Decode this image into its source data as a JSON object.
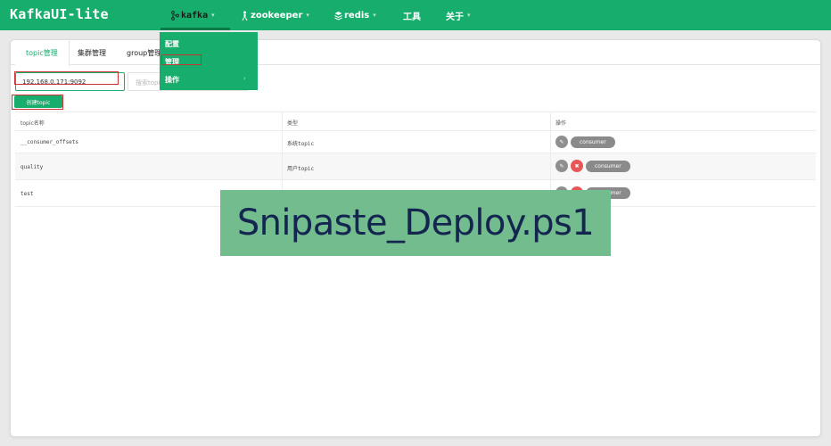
{
  "app": {
    "brand": "KafkaUI-lite"
  },
  "nav": {
    "kafka": {
      "icon": "kafka-icon",
      "label": "kafka"
    },
    "zookeeper": {
      "icon": "zookeeper-icon",
      "label": "zookeeper"
    },
    "redis": {
      "icon": "redis-icon",
      "label": "redis"
    },
    "tools": {
      "label": "工具"
    },
    "about": {
      "label": "关于"
    }
  },
  "dropdown": {
    "config": "配置",
    "manage": "管理",
    "ops": "操作"
  },
  "tabs": [
    {
      "label": "topic管理",
      "active": true
    },
    {
      "label": "集群管理",
      "active": false
    },
    {
      "label": "group管理",
      "active": false
    }
  ],
  "cluster_select": {
    "value": "192.168.0.171:9092"
  },
  "search": {
    "placeholder": "搜索topic"
  },
  "create_button": "创建topic",
  "table": {
    "headers": [
      "topic名称",
      "类型",
      "操作"
    ],
    "rows": [
      {
        "name": "__consumer_offsets",
        "type": "系统topic",
        "action": "consumer",
        "deletable": false
      },
      {
        "name": "quality",
        "type": "用户topic",
        "action": "consumer",
        "deletable": true
      },
      {
        "name": "test",
        "type": "",
        "action": "consumer",
        "deletable": true
      }
    ]
  },
  "overlay": {
    "text": "Snipaste_Deploy.ps1"
  },
  "colors": {
    "accent": "#17ad6c",
    "highlight": "#c93535",
    "overlay": "#72bc8e"
  }
}
